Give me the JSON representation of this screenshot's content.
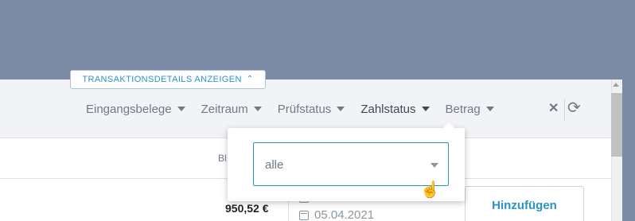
{
  "header": {
    "toggle_label": "TRANSAKTIONSDETAILS ANZEIGEN"
  },
  "filters": [
    {
      "label": "Eingangsbelege"
    },
    {
      "label": "Zeitraum"
    },
    {
      "label": "Prüfstatus"
    },
    {
      "label": "Zahlstatus",
      "active": true
    },
    {
      "label": "Betrag"
    }
  ],
  "subbar": {
    "text": "Bl"
  },
  "row": {
    "amount": "950,52 €",
    "date_1": "05.04.2021",
    "date_2": "05.04.2021",
    "add_label": "Hinzufügen"
  },
  "dropdown": {
    "selected": "alle"
  },
  "colors": {
    "accent": "#2b93c4",
    "overlay": "#7b8ba6"
  }
}
